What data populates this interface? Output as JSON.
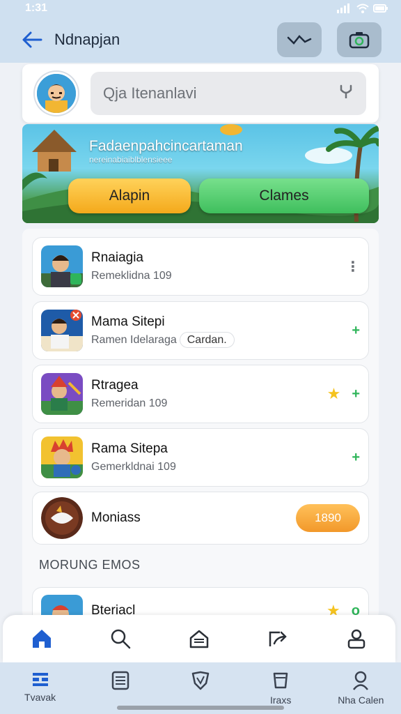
{
  "status_bar": {
    "time": "1:31"
  },
  "app_bar": {
    "title": "Ndnapjan"
  },
  "profile": {
    "search_placeholder": "Qja Itenanlavi"
  },
  "banner": {
    "title": "Fadaenpahcincartaman",
    "subtitle": "nereinabiaiblblensieee",
    "explore_label": "Alapin",
    "games_label": "Clames"
  },
  "list": {
    "items": [
      {
        "title": "Rnaiagia",
        "subtitle": "Remeklidna 109"
      },
      {
        "title": "Mama Sitepi",
        "subtitle": "Ramen Idelaraga",
        "chip": "Cardan."
      },
      {
        "title": "Rtragea",
        "subtitle": "Remeridan 109"
      },
      {
        "title": "Rama Sitepa",
        "subtitle": "Gemerkldnai 109"
      },
      {
        "title": "Moniass",
        "price": "1890"
      }
    ],
    "section_label": "MORUNG EMOS",
    "partial_item_title": "Bteriacl"
  },
  "nav": {
    "items": [
      {
        "label": "Tvavak"
      },
      {
        "label": ""
      },
      {
        "label": ""
      },
      {
        "label": "Iraxs"
      },
      {
        "label": "Nha Calen"
      }
    ]
  },
  "colors": {
    "accent": "#1f5fd0",
    "plus": "#2fb55a",
    "price": "#f2982a",
    "star": "#f5c31f"
  }
}
